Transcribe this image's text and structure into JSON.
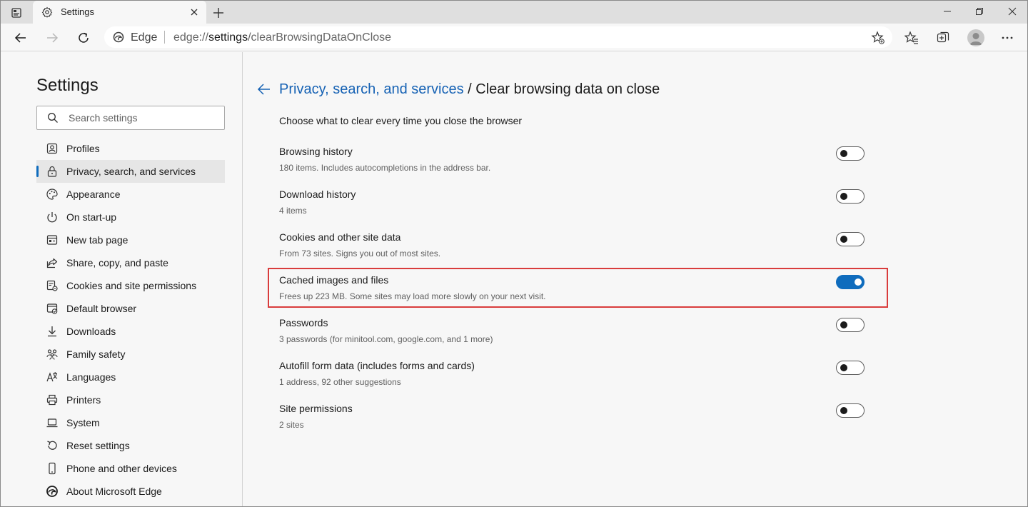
{
  "window": {
    "tab_title": "Settings",
    "colors": {
      "accent": "#0f6cbd",
      "link": "#1662b4",
      "highlight": "#d93c3c"
    }
  },
  "toolbar": {
    "address_site": "Edge",
    "url_scheme": "edge://",
    "url_host": "settings",
    "url_path": "/clearBrowsingDataOnClose"
  },
  "sidebar": {
    "title": "Settings",
    "search_placeholder": "Search settings",
    "items": [
      {
        "label": "Profiles",
        "icon": "profile-icon",
        "active": false
      },
      {
        "label": "Privacy, search, and services",
        "icon": "lock-icon",
        "active": true
      },
      {
        "label": "Appearance",
        "icon": "palette-icon",
        "active": false
      },
      {
        "label": "On start-up",
        "icon": "power-icon",
        "active": false
      },
      {
        "label": "New tab page",
        "icon": "new-tab-page-icon",
        "active": false
      },
      {
        "label": "Share, copy, and paste",
        "icon": "share-icon",
        "active": false
      },
      {
        "label": "Cookies and site permissions",
        "icon": "cookies-icon",
        "active": false
      },
      {
        "label": "Default browser",
        "icon": "default-browser-icon",
        "active": false
      },
      {
        "label": "Downloads",
        "icon": "download-icon",
        "active": false
      },
      {
        "label": "Family safety",
        "icon": "family-icon",
        "active": false
      },
      {
        "label": "Languages",
        "icon": "languages-icon",
        "active": false
      },
      {
        "label": "Printers",
        "icon": "printer-icon",
        "active": false
      },
      {
        "label": "System",
        "icon": "laptop-icon",
        "active": false
      },
      {
        "label": "Reset settings",
        "icon": "reset-icon",
        "active": false
      },
      {
        "label": "Phone and other devices",
        "icon": "phone-icon",
        "active": false
      },
      {
        "label": "About Microsoft Edge",
        "icon": "edge-logo-icon",
        "active": false
      }
    ]
  },
  "main": {
    "breadcrumb_parent": "Privacy, search, and services",
    "breadcrumb_sep": " / ",
    "breadcrumb_current": "Clear browsing data on close",
    "intro": "Choose what to clear every time you close the browser",
    "settings": [
      {
        "title": "Browsing history",
        "desc": "180 items. Includes autocompletions in the address bar.",
        "on": false
      },
      {
        "title": "Download history",
        "desc": "4 items",
        "on": false
      },
      {
        "title": "Cookies and other site data",
        "desc": "From 73 sites. Signs you out of most sites.",
        "on": false
      },
      {
        "title": "Cached images and files",
        "desc": "Frees up 223 MB. Some sites may load more slowly on your next visit.",
        "on": true,
        "highlighted": true
      },
      {
        "title": "Passwords",
        "desc": "3 passwords (for minitool.com, google.com, and 1 more)",
        "on": false
      },
      {
        "title": "Autofill form data (includes forms and cards)",
        "desc": "1 address, 92 other suggestions",
        "on": false
      },
      {
        "title": "Site permissions",
        "desc": "2 sites",
        "on": false
      }
    ]
  }
}
